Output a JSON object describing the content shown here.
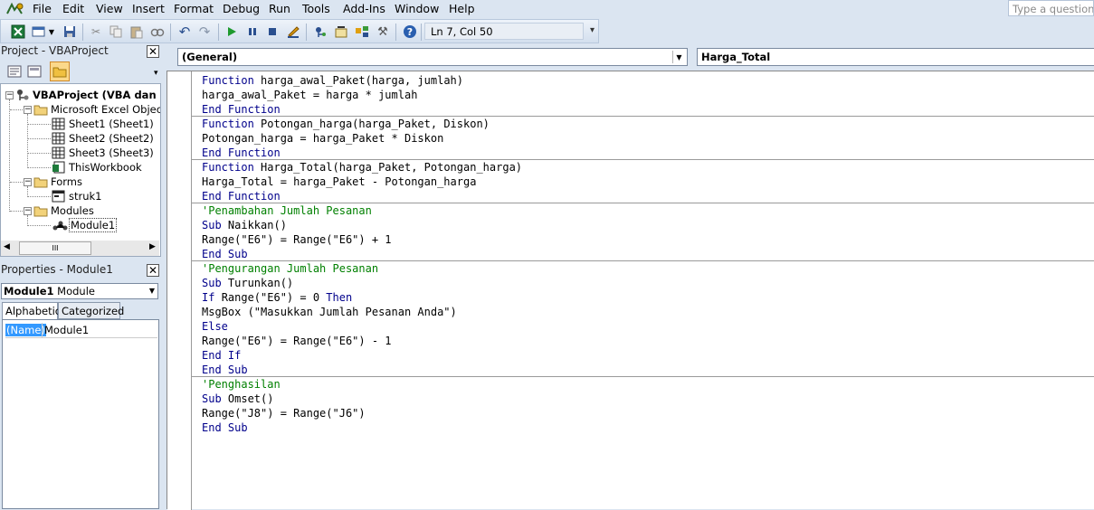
{
  "menu": [
    "File",
    "Edit",
    "View",
    "Insert",
    "Format",
    "Debug",
    "Run",
    "Tools",
    "Add-Ins",
    "Window",
    "Help"
  ],
  "help_placeholder": "Type a question f",
  "toolbar": {
    "status": "Ln 7, Col 50",
    "icons": [
      "excel-icon",
      "insert-userform-icon",
      "save-icon",
      "cut-icon",
      "copy-icon",
      "paste-icon",
      "find-icon",
      "undo-icon",
      "redo-icon",
      "run-icon",
      "break-icon",
      "reset-icon",
      "design-mode-icon",
      "project-explorer-icon",
      "properties-icon",
      "object-browser-icon",
      "toolbox-icon",
      "help-icon"
    ]
  },
  "project": {
    "title": "Project - VBAProject",
    "tree": [
      {
        "label": "VBAProject (VBA dan Ma",
        "level": 0,
        "icon": "vbaproject-icon",
        "bold": true
      },
      {
        "label": "Microsoft Excel Objects",
        "level": 1,
        "icon": "folder-icon"
      },
      {
        "label": "Sheet1 (Sheet1)",
        "level": 2,
        "icon": "sheet-icon"
      },
      {
        "label": "Sheet2 (Sheet2)",
        "level": 2,
        "icon": "sheet-icon"
      },
      {
        "label": "Sheet3 (Sheet3)",
        "level": 2,
        "icon": "sheet-icon"
      },
      {
        "label": "ThisWorkbook",
        "level": 2,
        "icon": "workbook-icon"
      },
      {
        "label": "Forms",
        "level": 1,
        "icon": "folder-icon"
      },
      {
        "label": "struk1",
        "level": 2,
        "icon": "form-icon"
      },
      {
        "label": "Modules",
        "level": 1,
        "icon": "folder-icon"
      },
      {
        "label": "Module1",
        "level": 2,
        "icon": "module-icon"
      }
    ],
    "scroll_grip": "III"
  },
  "properties": {
    "title": "Properties - Module1",
    "object_bold": "Module1",
    "object_type": "Module",
    "tabs": [
      "Alphabetic",
      "Categorized"
    ],
    "rows": [
      {
        "name": "(Name)",
        "value": "Module1"
      }
    ]
  },
  "code": {
    "object_combo": "(General)",
    "proc_combo": "Harga_Total",
    "procedures": [
      [
        [
          {
            "t": "Function ",
            "k": "kw"
          },
          {
            "t": "harga_awal_Paket(harga, jumlah)"
          }
        ],
        [
          {
            "t": "harga_awal_Paket = harga * jumlah"
          }
        ],
        [
          {
            "t": "End Function",
            "k": "kw"
          }
        ]
      ],
      [
        [
          {
            "t": "Function ",
            "k": "kw"
          },
          {
            "t": "Potongan_harga(harga_Paket, Diskon)"
          }
        ],
        [
          {
            "t": "Potongan_harga = harga_Paket * Diskon"
          }
        ],
        [
          {
            "t": "End Function",
            "k": "kw"
          }
        ]
      ],
      [
        [
          {
            "t": "Function ",
            "k": "kw"
          },
          {
            "t": "Harga_Total(harga_Paket, Potongan_harga)"
          }
        ],
        [
          {
            "t": "Harga_Total = harga_Paket - Potongan_harga"
          }
        ],
        [
          {
            "t": "End Function",
            "k": "kw"
          }
        ]
      ],
      [
        [
          {
            "t": "'Penambahan Jumlah Pesanan",
            "k": "cm"
          }
        ],
        [
          {
            "t": "Sub ",
            "k": "kw"
          },
          {
            "t": "Naikkan()"
          }
        ],
        [
          {
            "t": "Range(\"E6\") = Range(\"E6\") + 1"
          }
        ],
        [
          {
            "t": "End Sub",
            "k": "kw"
          }
        ]
      ],
      [
        [
          {
            "t": "'Pengurangan Jumlah Pesanan",
            "k": "cm"
          }
        ],
        [
          {
            "t": "Sub ",
            "k": "kw"
          },
          {
            "t": "Turunkan()"
          }
        ],
        [
          {
            "t": "If ",
            "k": "kw"
          },
          {
            "t": "Range(\"E6\") = 0 "
          },
          {
            "t": "Then",
            "k": "kw"
          }
        ],
        [
          {
            "t": "MsgBox (\"Masukkan Jumlah Pesanan Anda\")"
          }
        ],
        [
          {
            "t": "Else",
            "k": "kw"
          }
        ],
        [
          {
            "t": "Range(\"E6\") = Range(\"E6\") - 1"
          }
        ],
        [
          {
            "t": "End If",
            "k": "kw"
          }
        ],
        [
          {
            "t": "End Sub",
            "k": "kw"
          }
        ]
      ],
      [
        [
          {
            "t": "'Penghasilan",
            "k": "cm"
          }
        ],
        [
          {
            "t": "Sub ",
            "k": "kw"
          },
          {
            "t": "Omset()"
          }
        ],
        [
          {
            "t": "Range(\"J8\") = Range(\"J6\")"
          }
        ],
        [
          {
            "t": "End Sub",
            "k": "kw"
          }
        ]
      ]
    ]
  }
}
